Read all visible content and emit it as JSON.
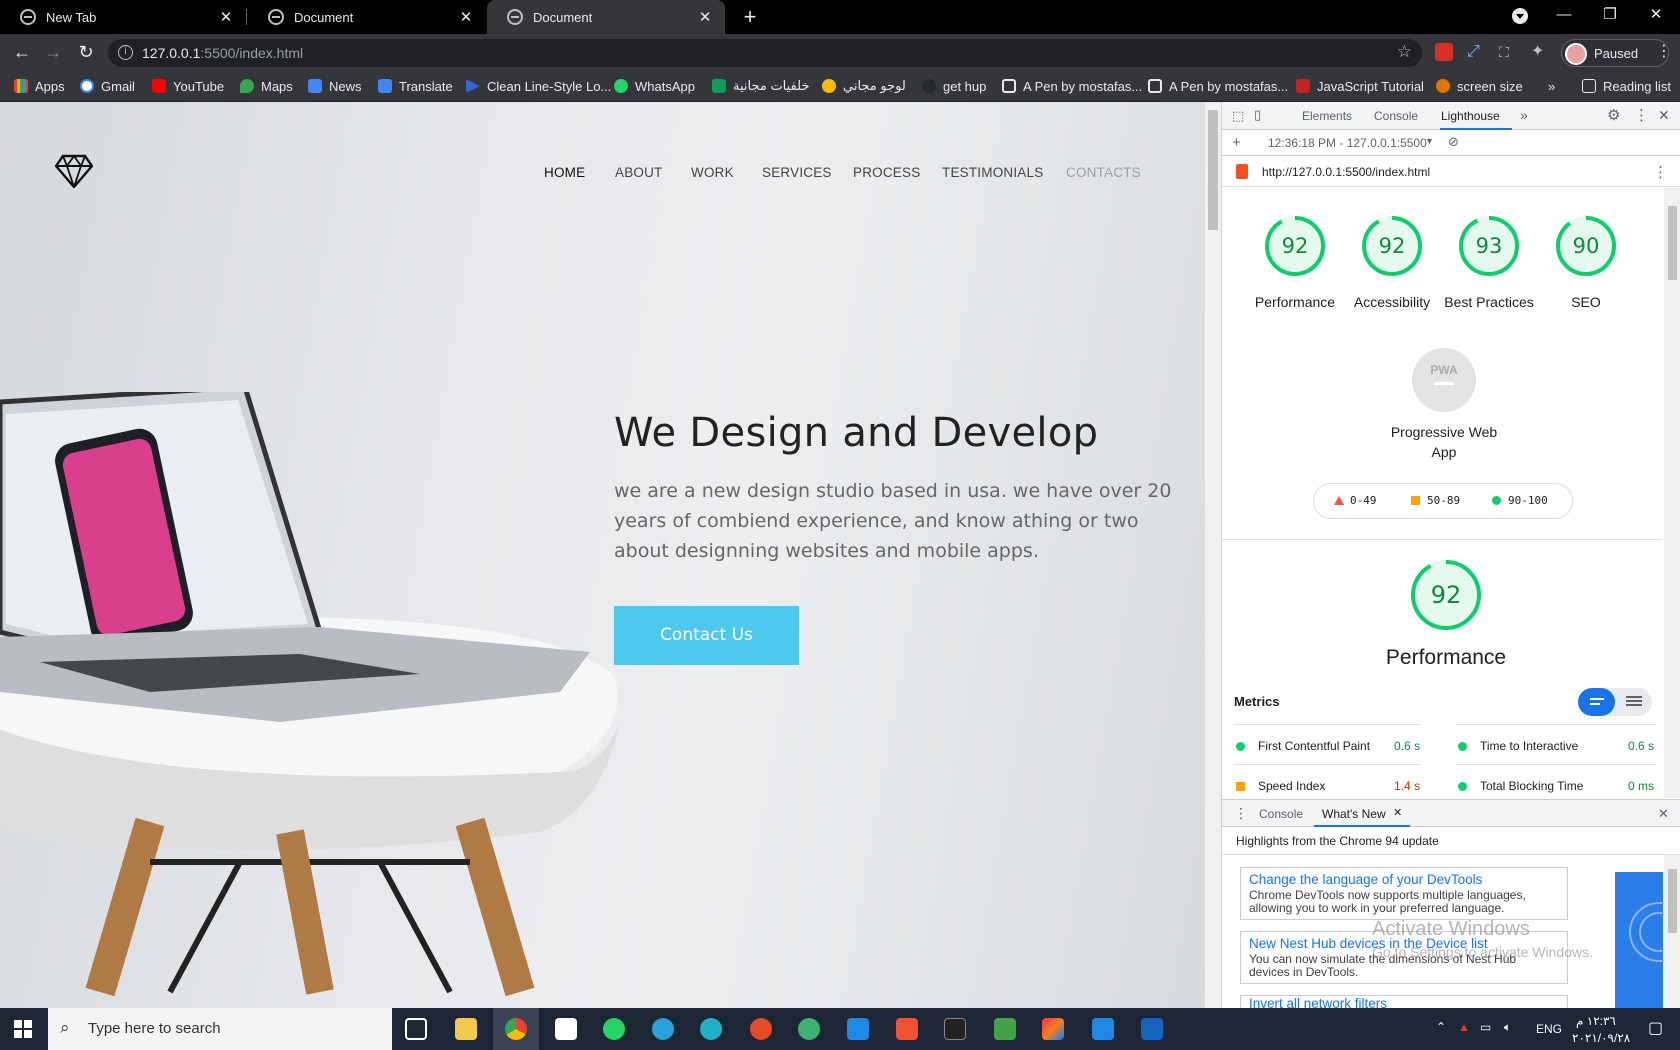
{
  "browser": {
    "tabs": [
      {
        "title": "New Tab",
        "active": false
      },
      {
        "title": "Document",
        "active": false
      },
      {
        "title": "Document",
        "active": true
      }
    ],
    "url_host": "127.0.0.1",
    "url_path": ":5500/index.html",
    "profile_label": "Paused",
    "bookmarks": [
      "Apps",
      "Gmail",
      "YouTube",
      "Maps",
      "News",
      "Translate",
      "Clean Line-Style Lo...",
      "WhatsApp",
      "خلفيات مجانية",
      "لوجو مجاني",
      "get hup",
      "A Pen by mostafas...",
      "A Pen by mostafas...",
      "JavaScript Tutorial",
      "screen size"
    ],
    "more_bookmarks": "»",
    "reading_list": "Reading list"
  },
  "site": {
    "nav": [
      "HOME",
      "ABOUT",
      "WORK",
      "SERVICES",
      "PROCESS",
      "TESTIMONIALS",
      "CONTACTS"
    ],
    "hero_title": "We Design and Develop",
    "hero_text": "we are a new design studio based in usa. we have over 20 years of combiend experience, and know athing or two about designning websites and mobile apps.",
    "cta": "Contact Us"
  },
  "devtools": {
    "tabs": [
      "Elements",
      "Console",
      "Lighthouse"
    ],
    "active_tab": "Lighthouse",
    "report_time": "12:36:18 PM - 127.0.0.1:5500",
    "report_url": "http://127.0.0.1:5500/index.html",
    "scores": [
      {
        "label": "Performance",
        "value": 92
      },
      {
        "label": "Accessibility",
        "value": 92
      },
      {
        "label": "Best Practices",
        "value": 93
      },
      {
        "label": "SEO",
        "value": 90
      }
    ],
    "pwa_badge": "PWA",
    "pwa_label": "Progressive Web App",
    "legend": [
      "0-49",
      "50-89",
      "90-100"
    ],
    "perf_score": 92,
    "perf_title": "Performance",
    "metrics_label": "Metrics",
    "metrics": [
      {
        "name": "First Contentful Paint",
        "value": "0.6 s",
        "status": "pass"
      },
      {
        "name": "Time to Interactive",
        "value": "0.6 s",
        "status": "pass"
      },
      {
        "name": "Speed Index",
        "value": "1.4 s",
        "status": "average"
      },
      {
        "name": "Total Blocking Time",
        "value": "0 ms",
        "status": "pass"
      }
    ],
    "drawer_tabs": [
      "Console",
      "What's New"
    ],
    "drawer_heading": "Highlights from the Chrome 94 update",
    "news": [
      {
        "title": "Change the language of your DevTools",
        "desc": "Chrome DevTools now supports multiple languages, allowing you to work in your preferred language."
      },
      {
        "title": "New Nest Hub devices in the Device list",
        "desc": "You can now simulate the dimensions of Nest Hub devices in DevTools."
      },
      {
        "title": "Invert all network filters",
        "desc": ""
      }
    ],
    "watermark_title": "Activate Windows",
    "watermark_sub": "Go to Settings to activate Windows."
  },
  "taskbar": {
    "search_placeholder": "Type here to search",
    "lang": "ENG",
    "time": "١٢:٣٦ م",
    "date": "٢٠٢١/٠٩/٢٨"
  },
  "colors": {
    "accent": "#4cc9ec",
    "pass": "#0cce6b",
    "average": "#ffa400",
    "fail": "#ff4e42"
  }
}
